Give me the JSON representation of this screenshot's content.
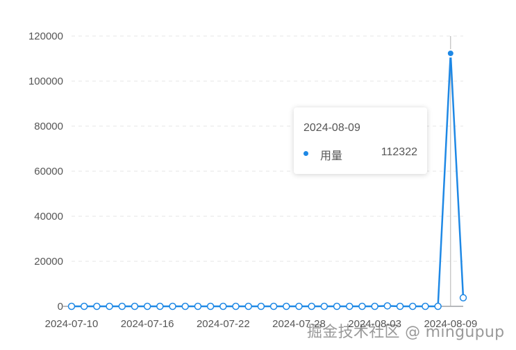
{
  "chart_data": {
    "type": "line",
    "x": [
      "2024-07-10",
      "2024-07-11",
      "2024-07-12",
      "2024-07-13",
      "2024-07-14",
      "2024-07-15",
      "2024-07-16",
      "2024-07-17",
      "2024-07-18",
      "2024-07-19",
      "2024-07-20",
      "2024-07-21",
      "2024-07-22",
      "2024-07-23",
      "2024-07-24",
      "2024-07-25",
      "2024-07-26",
      "2024-07-27",
      "2024-07-28",
      "2024-07-29",
      "2024-07-30",
      "2024-07-31",
      "2024-08-01",
      "2024-08-02",
      "2024-08-03",
      "2024-08-04",
      "2024-08-05",
      "2024-08-06",
      "2024-08-07",
      "2024-08-08",
      "2024-08-09",
      "2024-08-10"
    ],
    "x_tick_labels": [
      "2024-07-10",
      "2024-07-16",
      "2024-07-22",
      "2024-07-28",
      "2024-08-03",
      "2024-08-09"
    ],
    "series": [
      {
        "name": "用量",
        "values": [
          0,
          0,
          0,
          0,
          0,
          0,
          0,
          0,
          0,
          0,
          0,
          0,
          0,
          0,
          0,
          0,
          0,
          0,
          0,
          0,
          0,
          0,
          0,
          0,
          0,
          200,
          0,
          0,
          0,
          0,
          112322,
          3800
        ]
      }
    ],
    "ylim": [
      0,
      120000
    ],
    "y_ticks": [
      0,
      20000,
      40000,
      60000,
      80000,
      100000,
      120000
    ],
    "grid": true,
    "color": "#1e88e5",
    "title": "",
    "xlabel": "",
    "ylabel": ""
  },
  "tooltip": {
    "date": "2024-08-09",
    "series_name": "用量",
    "value": "112322",
    "color": "#1e88e5"
  },
  "watermark": "掘金技术社区 @ mingupup"
}
